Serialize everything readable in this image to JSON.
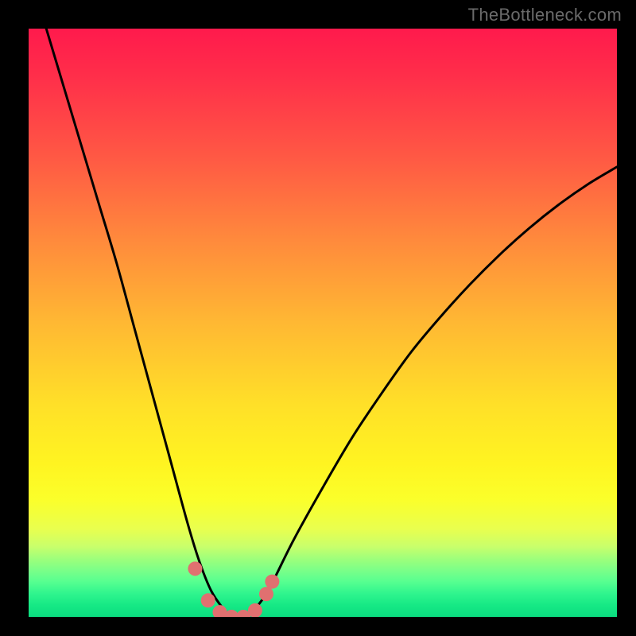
{
  "watermark": "TheBottleneck.com",
  "gradient_colors": {
    "top": "#ff1a4c",
    "mid_upper": "#ff8a3c",
    "mid": "#ffe028",
    "mid_lower": "#e9ff4e",
    "bottom": "#0bdc7f"
  },
  "curve_color": "#000000",
  "marker_color": "#e07070",
  "chart_data": {
    "type": "line",
    "title": "",
    "xlabel": "",
    "ylabel": "",
    "xlim": [
      0,
      1
    ],
    "ylim": [
      0,
      1
    ],
    "notes": "Axes are unlabeled in the source image; x and y are normalized 0–1. Curve is a V-shaped dip reaching ~0 near x≈0.34 with a flat bottom, then rising toward the right. Pink markers sit along the bottom of the dip.",
    "series": [
      {
        "name": "curve",
        "x": [
          0.03,
          0.06,
          0.09,
          0.12,
          0.15,
          0.18,
          0.21,
          0.24,
          0.27,
          0.29,
          0.31,
          0.33,
          0.345,
          0.36,
          0.375,
          0.39,
          0.41,
          0.45,
          0.5,
          0.55,
          0.6,
          0.65,
          0.7,
          0.75,
          0.8,
          0.85,
          0.9,
          0.95,
          1.0
        ],
        "y": [
          1.0,
          0.9,
          0.8,
          0.7,
          0.6,
          0.49,
          0.38,
          0.27,
          0.16,
          0.095,
          0.045,
          0.015,
          0.0,
          0.0,
          0.005,
          0.02,
          0.05,
          0.13,
          0.22,
          0.305,
          0.38,
          0.45,
          0.51,
          0.565,
          0.615,
          0.66,
          0.7,
          0.735,
          0.765
        ]
      },
      {
        "name": "markers",
        "x": [
          0.283,
          0.305,
          0.325,
          0.345,
          0.365,
          0.385,
          0.404,
          0.414
        ],
        "y": [
          0.082,
          0.028,
          0.008,
          0.0,
          0.0,
          0.011,
          0.039,
          0.06
        ]
      }
    ]
  }
}
